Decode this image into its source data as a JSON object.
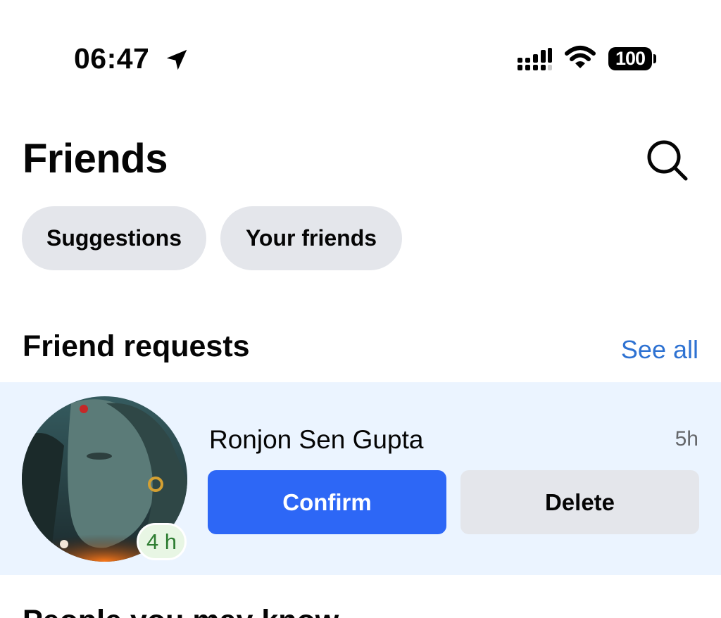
{
  "status_bar": {
    "time": "06:47",
    "battery": "100",
    "icons": [
      "location-arrow-icon",
      "signal-icon",
      "wifi-icon",
      "battery-icon"
    ]
  },
  "header": {
    "title": "Friends",
    "search_icon": "search-icon"
  },
  "chips": [
    {
      "label": "Suggestions"
    },
    {
      "label": "Your friends"
    }
  ],
  "friend_requests": {
    "title": "Friend requests",
    "see_all": "See all",
    "items": [
      {
        "name": "Ronjon Sen Gupta",
        "time": "5h",
        "avatar_badge": "4 h",
        "confirm_label": "Confirm",
        "delete_label": "Delete"
      }
    ]
  },
  "next_section": {
    "title": "People you may know"
  },
  "colors": {
    "accent_blue": "#2d67f6",
    "link_blue": "#2e72d2",
    "chip_gray": "#e4e6eb",
    "highlight_row": "#ebf4ff",
    "badge_green": "#2e7d32"
  }
}
